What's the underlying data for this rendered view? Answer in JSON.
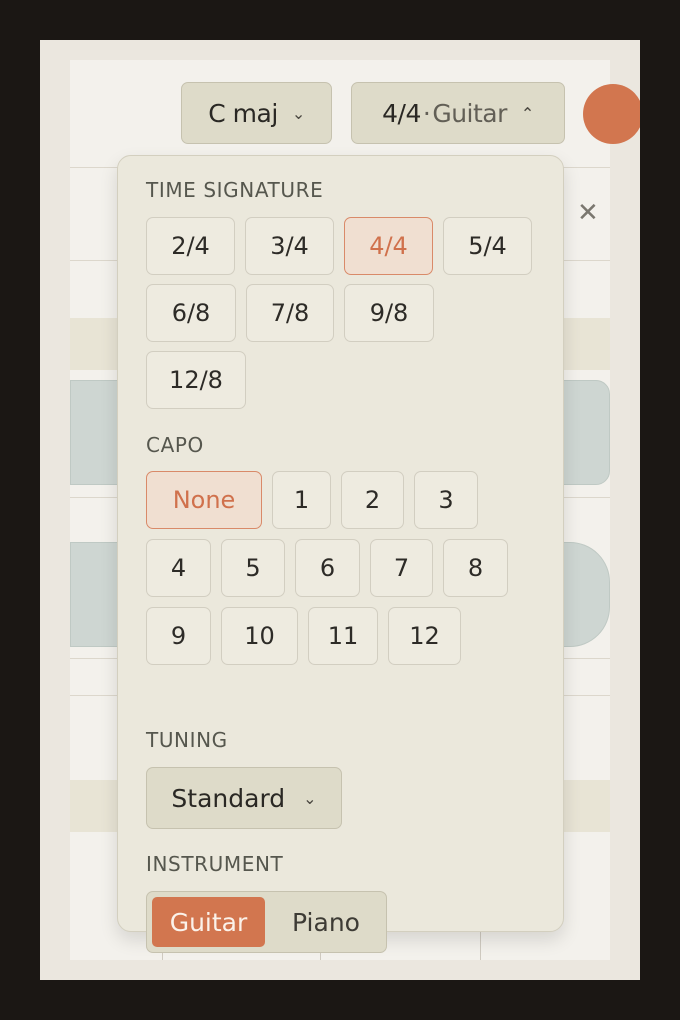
{
  "topbar": {
    "key_label": "C maj",
    "meter_label": "4/4",
    "meter_separator": "·",
    "instrument_label": "Guitar"
  },
  "popover": {
    "time_signature": {
      "label": "TIME SIGNATURE",
      "options": [
        "2/4",
        "3/4",
        "4/4",
        "5/4",
        "6/8",
        "7/8",
        "9/8",
        "12/8"
      ],
      "selected": "4/4"
    },
    "capo": {
      "label": "CAPO",
      "options": [
        "None",
        "1",
        "2",
        "3",
        "4",
        "5",
        "6",
        "7",
        "8",
        "9",
        "10",
        "11",
        "12"
      ],
      "selected": "None"
    },
    "tuning": {
      "label": "TUNING",
      "value": "Standard"
    },
    "instrument": {
      "label": "INSTRUMENT",
      "options": [
        "Guitar",
        "Piano"
      ],
      "selected": "Guitar"
    }
  },
  "icons": {
    "close": "close-icon",
    "chevron_down": "chevron-down-icon",
    "chevron_up": "chevron-up-icon"
  },
  "colors": {
    "accent": "#d2764f",
    "selected_bg": "#f0dfd1",
    "panel_bg": "#ebe8dc",
    "button_bg": "#dedbc9"
  }
}
